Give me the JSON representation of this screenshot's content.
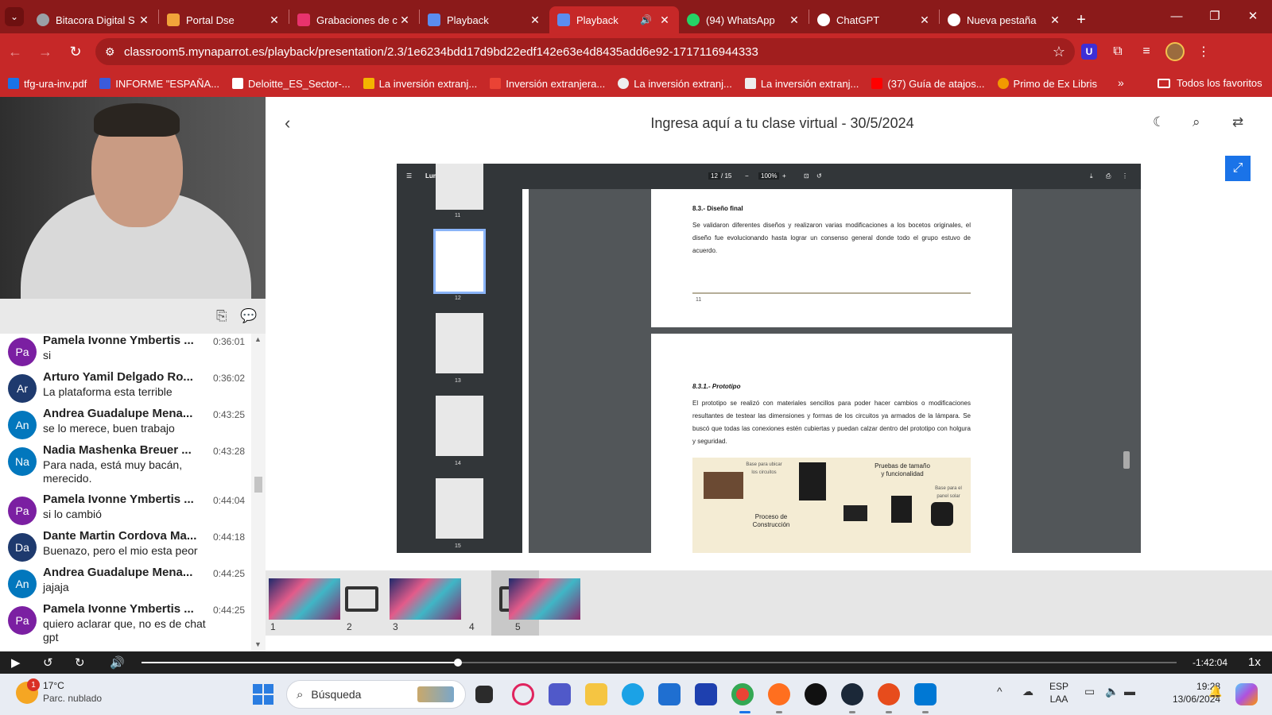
{
  "browser": {
    "tabs": [
      {
        "label": "Bitacora Digital S",
        "fav": "#9aa0a6"
      },
      {
        "label": "Portal Dse",
        "fav": "#f1a33a"
      },
      {
        "label": "Grabaciones de c",
        "fav": "#e8336d"
      },
      {
        "label": "Playback",
        "fav": "#5b8def"
      },
      {
        "label": "Playback",
        "fav": "#5b8def",
        "active": true
      },
      {
        "label": "(94) WhatsApp",
        "fav": "#25d366"
      },
      {
        "label": "ChatGPT",
        "fav": "#ffffff"
      },
      {
        "label": "Nueva pestaña",
        "fav": "#ffffff"
      }
    ],
    "url": "classroom5.mynaparrot.es/playback/presentation/2.3/1e6234bdd17d9bd22edf142e63e4d8435add6e92-1717116944333",
    "bookmarks": [
      {
        "label": "tfg-ura-inv.pdf",
        "color": "#1a73e8"
      },
      {
        "label": "INFORME \"ESPAÑA...",
        "color": "#3b5bdb"
      },
      {
        "label": "Deloitte_ES_Sector-...",
        "color": "#ffffff"
      },
      {
        "label": "La inversión extranj...",
        "color": "#f4b400"
      },
      {
        "label": "Inversión extranjera...",
        "color": "#ea4335"
      },
      {
        "label": "La inversión extranj...",
        "color": "#eeeeee"
      },
      {
        "label": "La inversión extranj...",
        "color": "#eeeeee"
      },
      {
        "label": "(37) Guía de atajos...",
        "color": "#ff0000"
      },
      {
        "label": "Primo de Ex Libris",
        "color": "#f29900"
      }
    ],
    "bookmarks_more": "»",
    "bookmarks_all": "Todos los favoritos",
    "brand_color": "#c62828"
  },
  "chat": {
    "messages": [
      {
        "initials": "Pa",
        "color": "#7b1fa2",
        "name": "Pamela Ivonne Ymbertis ...",
        "time": "0:36:01",
        "text": "si"
      },
      {
        "initials": "Ar",
        "color": "#1e3a6e",
        "name": "Arturo Yamil Delgado Ro...",
        "time": "0:36:02",
        "text": "La plataforma esta terrible"
      },
      {
        "initials": "An",
        "color": "#0277bd",
        "name": "Andrea Guadalupe Mena...",
        "time": "0:43:25",
        "text": "se lo merece, buen trabajo"
      },
      {
        "initials": "Na",
        "color": "#0277bd",
        "name": "Nadia Mashenka Breuer ...",
        "time": "0:43:28",
        "text": "Para nada, está muy bacán, merecido."
      },
      {
        "initials": "Pa",
        "color": "#7b1fa2",
        "name": "Pamela Ivonne Ymbertis ...",
        "time": "0:44:04",
        "text": "si lo cambió"
      },
      {
        "initials": "Da",
        "color": "#1e3a6e",
        "name": "Dante Martin Cordova Ma...",
        "time": "0:44:18",
        "text": "Buenazo, pero el mio esta peor"
      },
      {
        "initials": "An",
        "color": "#0277bd",
        "name": "Andrea Guadalupe Mena...",
        "time": "0:44:25",
        "text": "jajaja"
      },
      {
        "initials": "Pa",
        "color": "#7b1fa2",
        "name": "Pamela Ivonne Ymbertis ...",
        "time": "0:44:25",
        "text": "quiero aclarar que, no es de chat gpt"
      }
    ]
  },
  "main": {
    "title": "Ingresa aquí a tu clase virtual - 30/5/2024",
    "pdf": {
      "doc_title": "Lumiteck - Informe",
      "page_indicator": "12",
      "page_total": "/ 15",
      "zoom": "100%",
      "thumb_numbers": [
        "11",
        "12",
        "13",
        "14",
        "15"
      ],
      "section_heading": "8.3.- Diseño final",
      "section_text": "Se validaron diferentes diseños y realizaron varias modificaciones a los bocetos originales, el diseño fue evolucionando hasta lograr un consenso general donde todo el grupo estuvo de acuerdo.",
      "page_number": "11",
      "subsection_heading": "8.3.1.- Prototipo",
      "subsection_text": "El prototipo se realizó con materiales sencillos para poder hacer cambios o modificaciones resultantes de testear las dimensiones y formas de los circuitos ya armados de la lámpara. Se buscó que todas las conexiones estén cubiertas y puedan calzar dentro del prototipo con holgura y seguridad.",
      "photo_labels": {
        "base_circuits": "Base para ubicar los circuitos",
        "process": "Proceso de Construcción",
        "tests": "Pruebas de tamaño y funcionalidad",
        "base_panel": "Base para el panel solar"
      }
    },
    "slides": [
      "1",
      "2",
      "3",
      "4",
      "5"
    ],
    "selected_slide": "4"
  },
  "player": {
    "time_remaining": "-1:42:04",
    "speed": "1x",
    "progress": 0.306
  },
  "taskbar": {
    "weather_temp": "17°C",
    "weather_desc": "Parc. nublado",
    "weather_badge": "1",
    "search_placeholder": "Búsqueda",
    "lang_1": "ESP",
    "lang_2": "LAA",
    "time": "19:28",
    "date": "13/06/2024"
  }
}
